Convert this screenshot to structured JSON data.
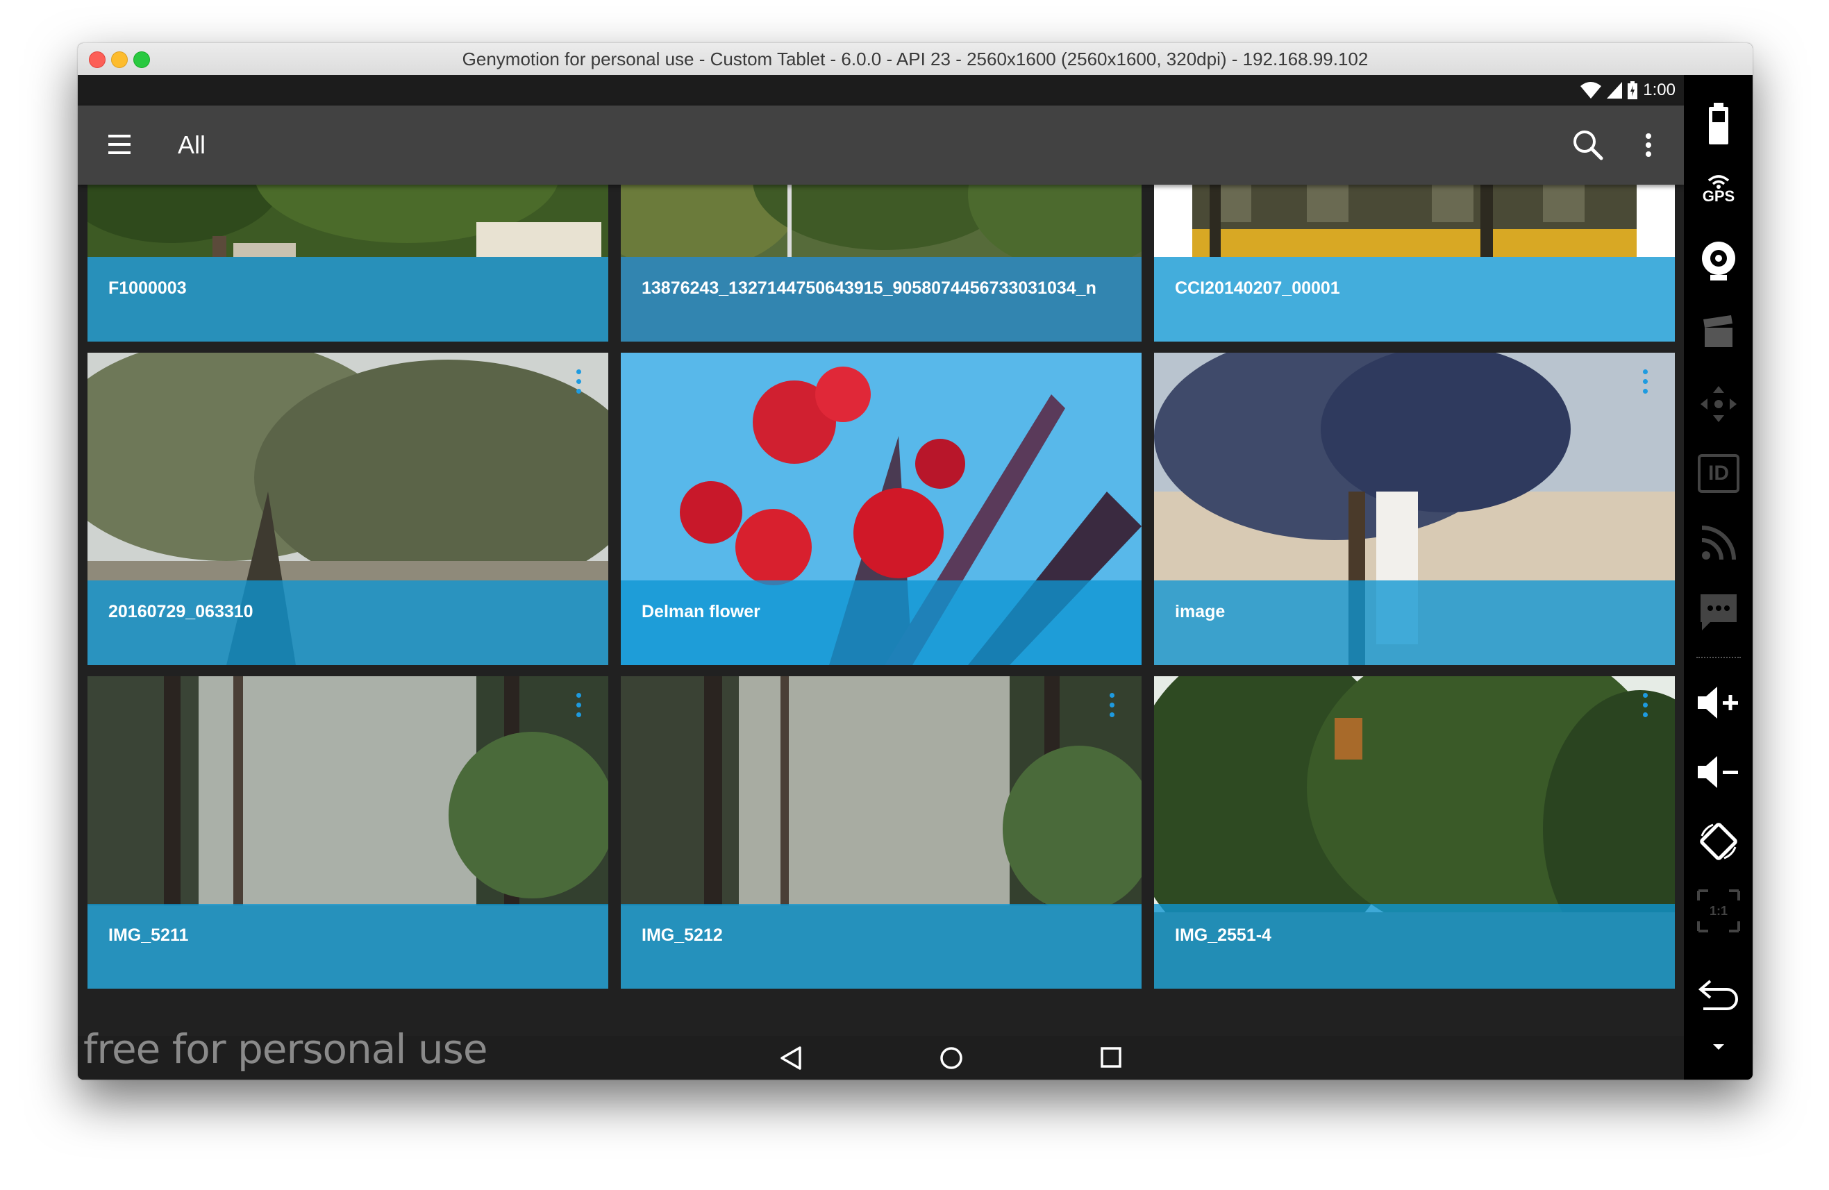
{
  "window": {
    "title": "Genymotion for personal use - Custom Tablet - 6.0.0 - API 23 - 2560x1600 (2560x1600, 320dpi) - 192.168.99.102"
  },
  "statusbar": {
    "time": "1:00"
  },
  "appbar": {
    "title": "All",
    "icons": [
      "menu-icon",
      "search-icon",
      "more-vert-icon"
    ]
  },
  "gallery": {
    "items": [
      {
        "name": "F1000003"
      },
      {
        "name": "13876243_1327144750643915_9058074456733031034_n"
      },
      {
        "name": "CCI20140207_00001"
      },
      {
        "name": "20160729_063310"
      },
      {
        "name": "Delman flower"
      },
      {
        "name": "image"
      },
      {
        "name": "IMG_5211"
      },
      {
        "name": "IMG_5212"
      },
      {
        "name": "IMG_2551-4"
      }
    ]
  },
  "navbar": {
    "icons": [
      "back-icon",
      "home-icon",
      "recents-icon"
    ]
  },
  "watermark": "free for personal use",
  "sidebar": {
    "gps_label": "GPS",
    "id_label": "ID",
    "scale_label": "1:1",
    "icons": [
      "battery-icon",
      "gps-icon",
      "camera-icon",
      "capture-icon",
      "dpad-icon",
      "id-icon",
      "rss-icon",
      "sms-icon",
      "volume-up-icon",
      "volume-down-icon",
      "rotate-icon",
      "scale-icon",
      "back-arrow-icon",
      "expand-icon"
    ]
  }
}
